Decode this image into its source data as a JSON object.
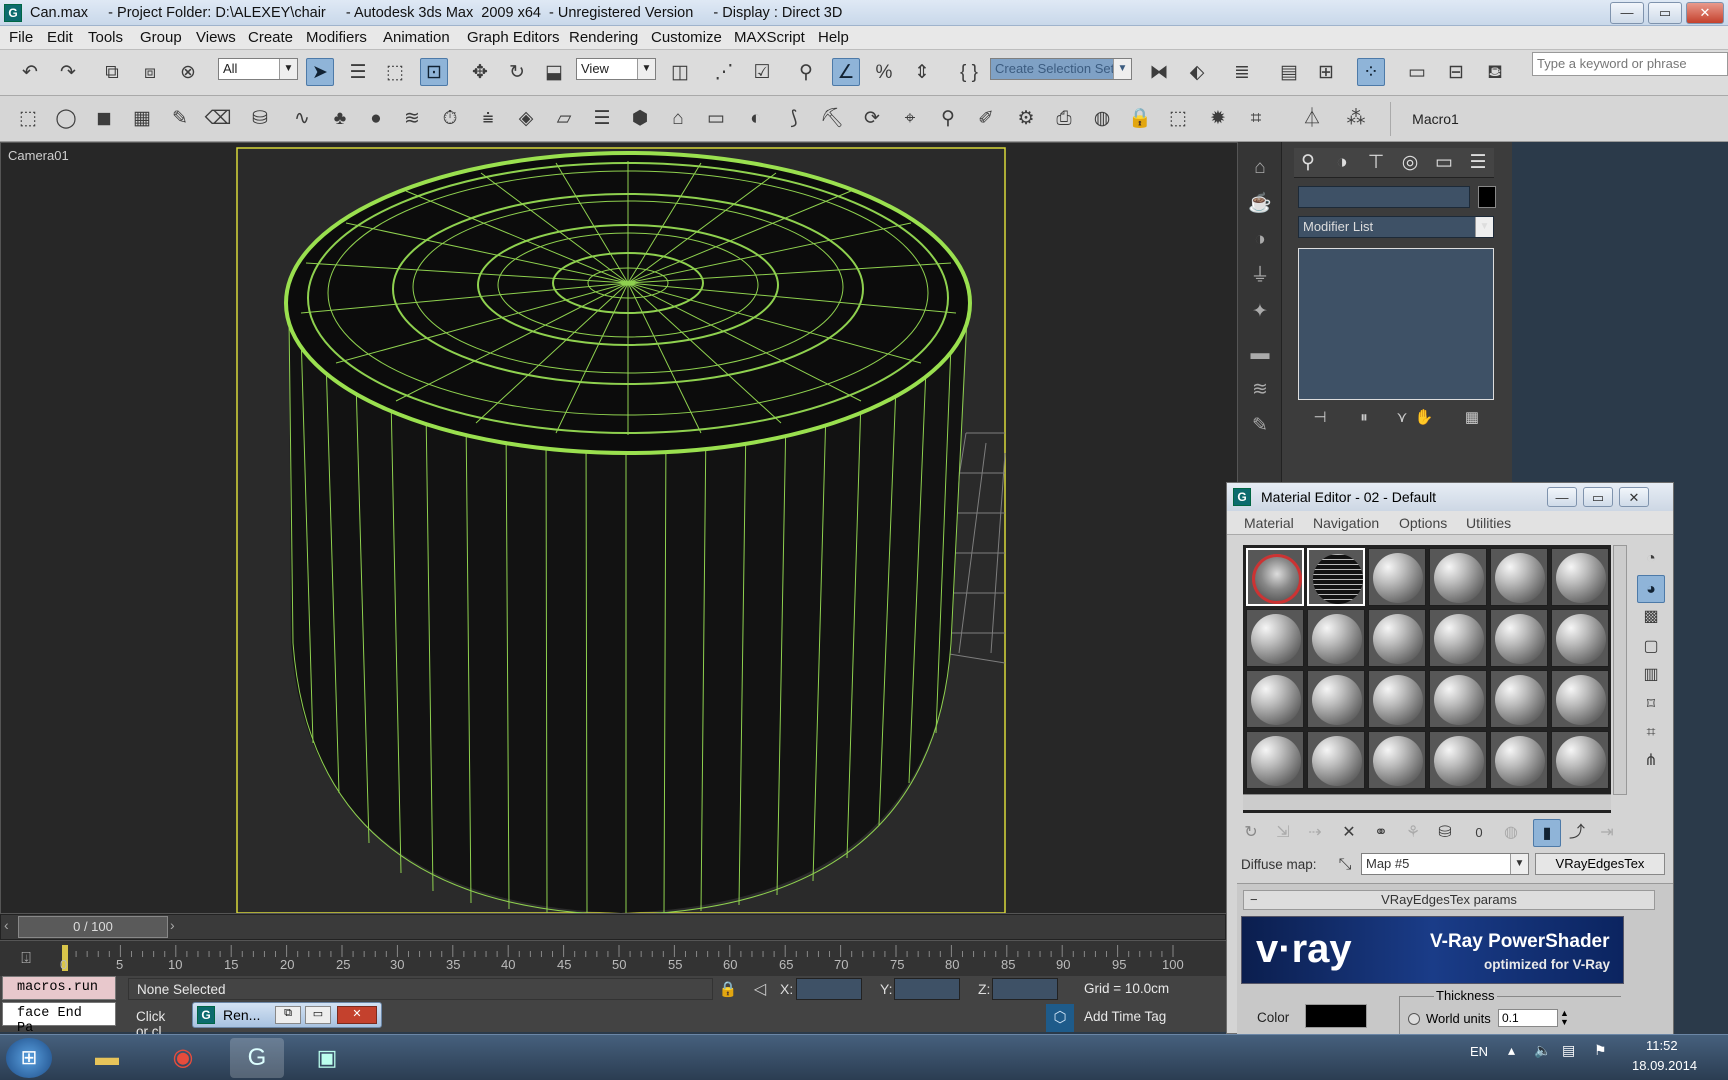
{
  "window": {
    "title": "Can.max     - Project Folder: D:\\ALEXEY\\chair     - Autodesk 3ds Max  2009 x64  - Unregistered Version     - Display : Direct 3D",
    "min": "—",
    "max": "▭",
    "close": "✕"
  },
  "menu": [
    "File",
    "Edit",
    "Tools",
    "Group",
    "Views",
    "Create",
    "Modifiers",
    "Animation",
    "Graph Editors",
    "Rendering",
    "Customize",
    "MAXScript",
    "Help"
  ],
  "toolbar": {
    "filter_value": "All",
    "view_value": "View",
    "selset_placeholder": "Create Selection Set",
    "search_placeholder": "Type a keyword or phrase",
    "macro_label": "Macro1"
  },
  "viewport": {
    "label": "Camera01"
  },
  "command_panel": {
    "modifier_list": "Modifier List"
  },
  "material_editor": {
    "title": "Material Editor - 02 - Default",
    "menus": [
      "Material",
      "Navigation",
      "Options",
      "Utilities"
    ],
    "diffuse_label": "Diffuse map:",
    "map_value": "Map #5",
    "map_type": "VRayEdgesTex",
    "rollout_title": "VRayEdgesTex params",
    "banner_brand": "v·ray",
    "banner_title": "V-Ray PowerShader",
    "banner_sub": "optimized for V-Ray",
    "color_label": "Color",
    "thickness_label": "Thickness",
    "world_units_label": "World units",
    "world_units_value": "0.1",
    "o_label": "0"
  },
  "timeline": {
    "frame_counter": "0 / 100",
    "ticks": [
      "0",
      "5",
      "10",
      "15",
      "20",
      "25",
      "30",
      "35",
      "40",
      "45",
      "50",
      "55",
      "60",
      "65",
      "70",
      "75",
      "80",
      "85",
      "90",
      "95",
      "100"
    ]
  },
  "status": {
    "macro_line1": "macros.run",
    "macro_line2": "face End Pa",
    "selection": "None Selected",
    "prompt": "Click or cl",
    "x_label": "X:",
    "y_label": "Y:",
    "z_label": "Z:",
    "grid": "Grid = 10.0cm",
    "add_time_tag": "Add Time Tag",
    "render_window": "Ren..."
  },
  "taskbar": {
    "lang": "EN",
    "time": "11:52",
    "date": "18.09.2014"
  }
}
